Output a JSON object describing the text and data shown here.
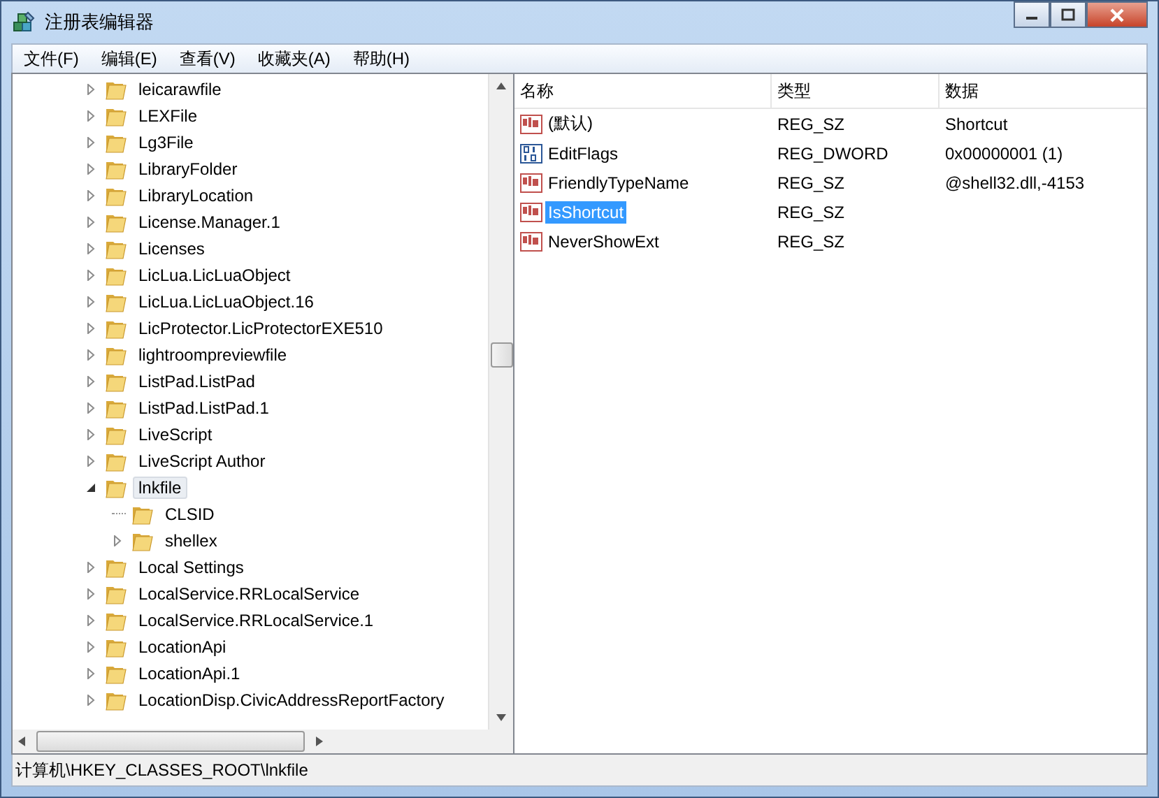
{
  "window": {
    "title": "注册表编辑器"
  },
  "menu": [
    "文件(F)",
    "编辑(E)",
    "查看(V)",
    "收藏夹(A)",
    "帮助(H)"
  ],
  "tree": {
    "items": [
      {
        "label": "leicarawfile",
        "expandable": true,
        "expanded": false,
        "selected": false
      },
      {
        "label": "LEXFile",
        "expandable": true,
        "expanded": false,
        "selected": false
      },
      {
        "label": "Lg3File",
        "expandable": true,
        "expanded": false,
        "selected": false
      },
      {
        "label": "LibraryFolder",
        "expandable": true,
        "expanded": false,
        "selected": false
      },
      {
        "label": "LibraryLocation",
        "expandable": true,
        "expanded": false,
        "selected": false
      },
      {
        "label": "License.Manager.1",
        "expandable": true,
        "expanded": false,
        "selected": false
      },
      {
        "label": "Licenses",
        "expandable": true,
        "expanded": false,
        "selected": false
      },
      {
        "label": "LicLua.LicLuaObject",
        "expandable": true,
        "expanded": false,
        "selected": false
      },
      {
        "label": "LicLua.LicLuaObject.16",
        "expandable": true,
        "expanded": false,
        "selected": false
      },
      {
        "label": "LicProtector.LicProtectorEXE510",
        "expandable": true,
        "expanded": false,
        "selected": false
      },
      {
        "label": "lightroompreviewfile",
        "expandable": true,
        "expanded": false,
        "selected": false
      },
      {
        "label": "ListPad.ListPad",
        "expandable": true,
        "expanded": false,
        "selected": false
      },
      {
        "label": "ListPad.ListPad.1",
        "expandable": true,
        "expanded": false,
        "selected": false
      },
      {
        "label": "LiveScript",
        "expandable": true,
        "expanded": false,
        "selected": false
      },
      {
        "label": "LiveScript Author",
        "expandable": true,
        "expanded": false,
        "selected": false
      },
      {
        "label": "lnkfile",
        "expandable": true,
        "expanded": true,
        "selected": true,
        "children": [
          {
            "label": "CLSID",
            "expandable": false,
            "expanded": false,
            "selected": false
          },
          {
            "label": "shellex",
            "expandable": true,
            "expanded": false,
            "selected": false
          }
        ]
      },
      {
        "label": "Local Settings",
        "expandable": true,
        "expanded": false,
        "selected": false
      },
      {
        "label": "LocalService.RRLocalService",
        "expandable": true,
        "expanded": false,
        "selected": false
      },
      {
        "label": "LocalService.RRLocalService.1",
        "expandable": true,
        "expanded": false,
        "selected": false
      },
      {
        "label": "LocationApi",
        "expandable": true,
        "expanded": false,
        "selected": false
      },
      {
        "label": "LocationApi.1",
        "expandable": true,
        "expanded": false,
        "selected": false
      },
      {
        "label": "LocationDisp.CivicAddressReportFactory",
        "expandable": true,
        "expanded": false,
        "selected": false
      }
    ]
  },
  "values": {
    "columns": [
      "名称",
      "类型",
      "数据"
    ],
    "rows": [
      {
        "kind": "string",
        "name": "(默认)",
        "type": "REG_SZ",
        "data": "Shortcut",
        "selected": false
      },
      {
        "kind": "binary",
        "name": "EditFlags",
        "type": "REG_DWORD",
        "data": "0x00000001 (1)",
        "selected": false
      },
      {
        "kind": "string",
        "name": "FriendlyTypeName",
        "type": "REG_SZ",
        "data": "@shell32.dll,-4153",
        "selected": false
      },
      {
        "kind": "string",
        "name": "IsShortcut",
        "type": "REG_SZ",
        "selected": true
      },
      {
        "kind": "string",
        "name": "NeverShowExt",
        "type": "REG_SZ",
        "selected": false
      }
    ]
  },
  "status_bar": "计算机\\HKEY_CLASSES_ROOT\\lnkfile"
}
